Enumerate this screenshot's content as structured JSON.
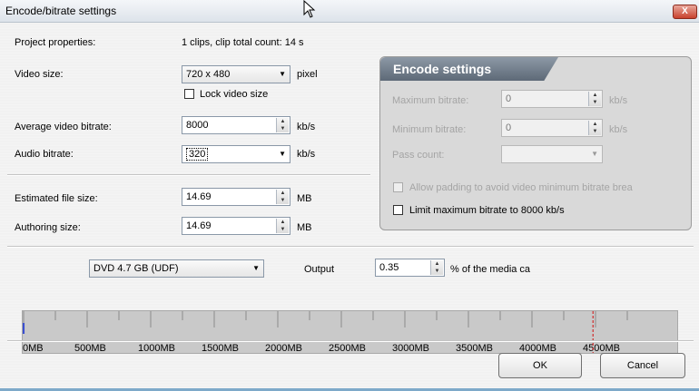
{
  "window": {
    "title": "Encode/bitrate settings",
    "close_label": "X"
  },
  "project": {
    "label": "Project properties:",
    "value": "1 clips,  clip total count: 14 s"
  },
  "video_size": {
    "label": "Video size:",
    "value": "720 x 480",
    "unit": "pixel",
    "lock_label": "Lock video size",
    "lock_checked": false
  },
  "avg_bitrate": {
    "label": "Average video bitrate:",
    "value": "8000",
    "unit": "kb/s"
  },
  "audio_bitrate": {
    "label": "Audio bitrate:",
    "value": "320",
    "unit": "kb/s"
  },
  "est_size": {
    "label": "Estimated file size:",
    "value": "14.69",
    "unit": "MB"
  },
  "authoring_size": {
    "label": "Authoring size:",
    "value": "14.69",
    "unit": "MB"
  },
  "encode": {
    "title": "Encode settings",
    "max_bitrate": {
      "label": "Maximum bitrate:",
      "value": "0",
      "unit": "kb/s"
    },
    "min_bitrate": {
      "label": "Minimum bitrate:",
      "value": "0",
      "unit": "kb/s"
    },
    "pass_count": {
      "label": "Pass count:",
      "value": ""
    },
    "padding_label": "Allow padding to avoid video minimum bitrate break",
    "limit_label": "Limit maximum bitrate to 8000 kb/s"
  },
  "output": {
    "disc": "DVD 4.7 GB (UDF)",
    "label": "Output",
    "value": "0.35",
    "unit": "% of the media ca"
  },
  "chart_data": {
    "type": "bar",
    "categories": [
      "0MB",
      "500MB",
      "1000MB",
      "1500MB",
      "2000MB",
      "2500MB",
      "3000MB",
      "3500MB",
      "4000MB",
      "4500MB"
    ],
    "used_mb": 14.69,
    "capacity_limit_mb": 4480,
    "xlim": [
      0,
      5000
    ]
  },
  "buttons": {
    "ok": "OK",
    "cancel": "Cancel"
  },
  "colors": {
    "used_bar": "#3a4fd0",
    "limit_line": "#d01010",
    "header": "#6b7785"
  }
}
